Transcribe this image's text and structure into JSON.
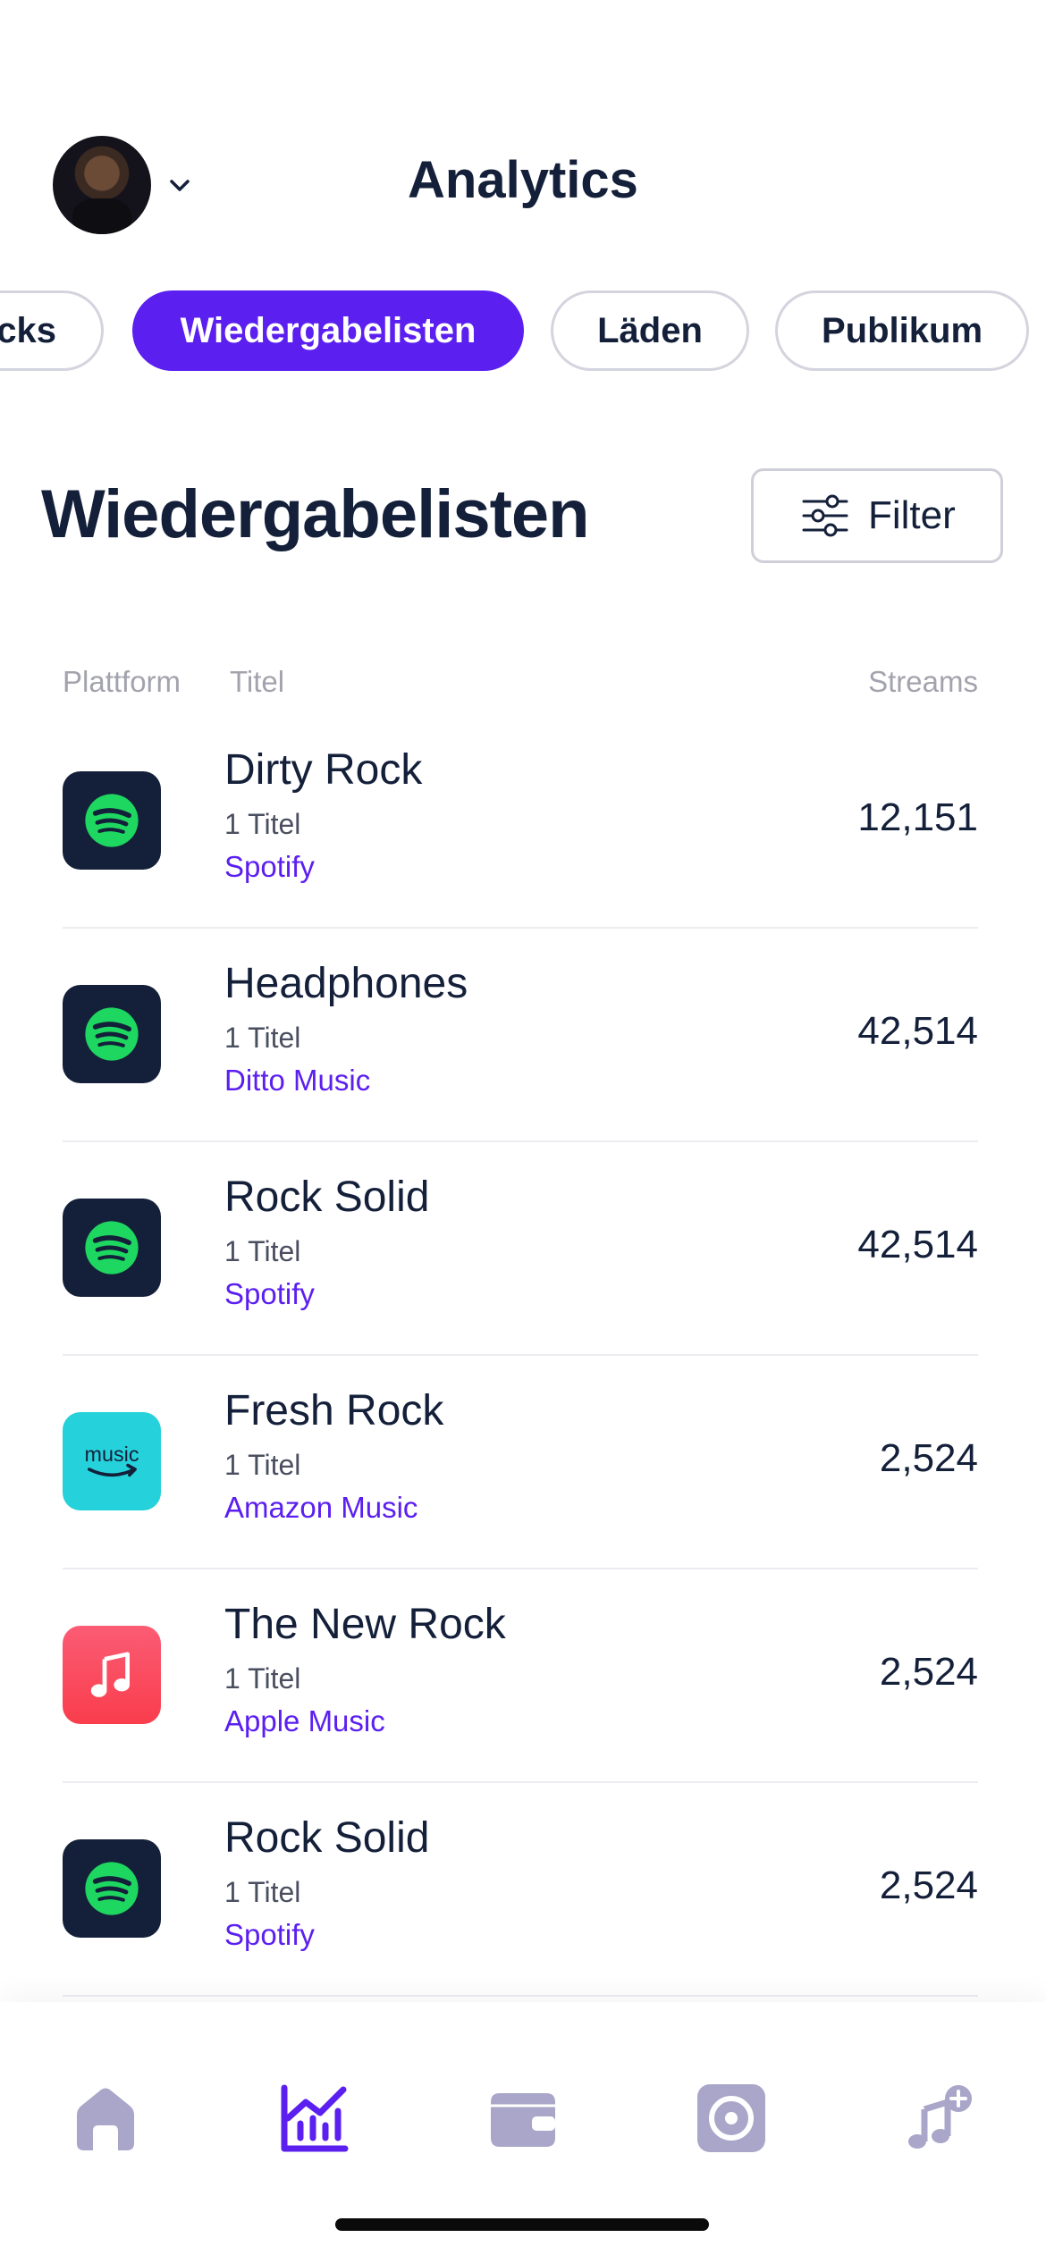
{
  "header": {
    "title": "Analytics",
    "avatar_icon": "profile-avatar",
    "chevron_icon": "chevron-down-icon"
  },
  "tabs": [
    {
      "label": "Tracks",
      "visible_text": "cks",
      "active": false
    },
    {
      "label": "Wiedergabelisten",
      "active": true
    },
    {
      "label": "Läden",
      "active": false
    },
    {
      "label": "Publikum",
      "active": false
    }
  ],
  "section": {
    "title": "Wiedergabelisten",
    "filter_label": "Filter",
    "filter_icon": "sliders-icon"
  },
  "table": {
    "columns": {
      "platform": "Plattform",
      "title": "Titel",
      "streams": "Streams"
    },
    "rows": [
      {
        "title": "Dirty Rock",
        "count": "1 Titel",
        "platform": "Spotify",
        "icon": "spotify-icon",
        "streams": "12,151"
      },
      {
        "title": "Headphones",
        "count": "1 Titel",
        "platform": "Ditto Music",
        "icon": "spotify-icon",
        "streams": "42,514"
      },
      {
        "title": "Rock Solid",
        "count": "1 Titel",
        "platform": "Spotify",
        "icon": "spotify-icon",
        "streams": "42,514"
      },
      {
        "title": "Fresh Rock",
        "count": "1 Titel",
        "platform": "Amazon Music",
        "icon": "amazon-music-icon",
        "streams": "2,524"
      },
      {
        "title": "The New Rock",
        "count": "1 Titel",
        "platform": "Apple Music",
        "icon": "apple-music-icon",
        "streams": "2,524"
      },
      {
        "title": "Rock Solid",
        "count": "1 Titel",
        "platform": "Spotify",
        "icon": "spotify-icon",
        "streams": "2,524"
      }
    ]
  },
  "bottom_nav": [
    {
      "icon": "home-icon",
      "active": false
    },
    {
      "icon": "analytics-icon",
      "active": true
    },
    {
      "icon": "wallet-icon",
      "active": false
    },
    {
      "icon": "release-icon",
      "active": false
    },
    {
      "icon": "add-music-icon",
      "active": false
    }
  ],
  "colors": {
    "accent": "#5b1ff0",
    "text_dark": "#14203a",
    "muted": "#a3a3ae",
    "nav_inactive": "#a9a6c9",
    "spotify_green": "#1ed760",
    "spotify_bg": "#14203a",
    "amazon_bg": "#25d1da",
    "apple_bg": "#f94c57"
  }
}
